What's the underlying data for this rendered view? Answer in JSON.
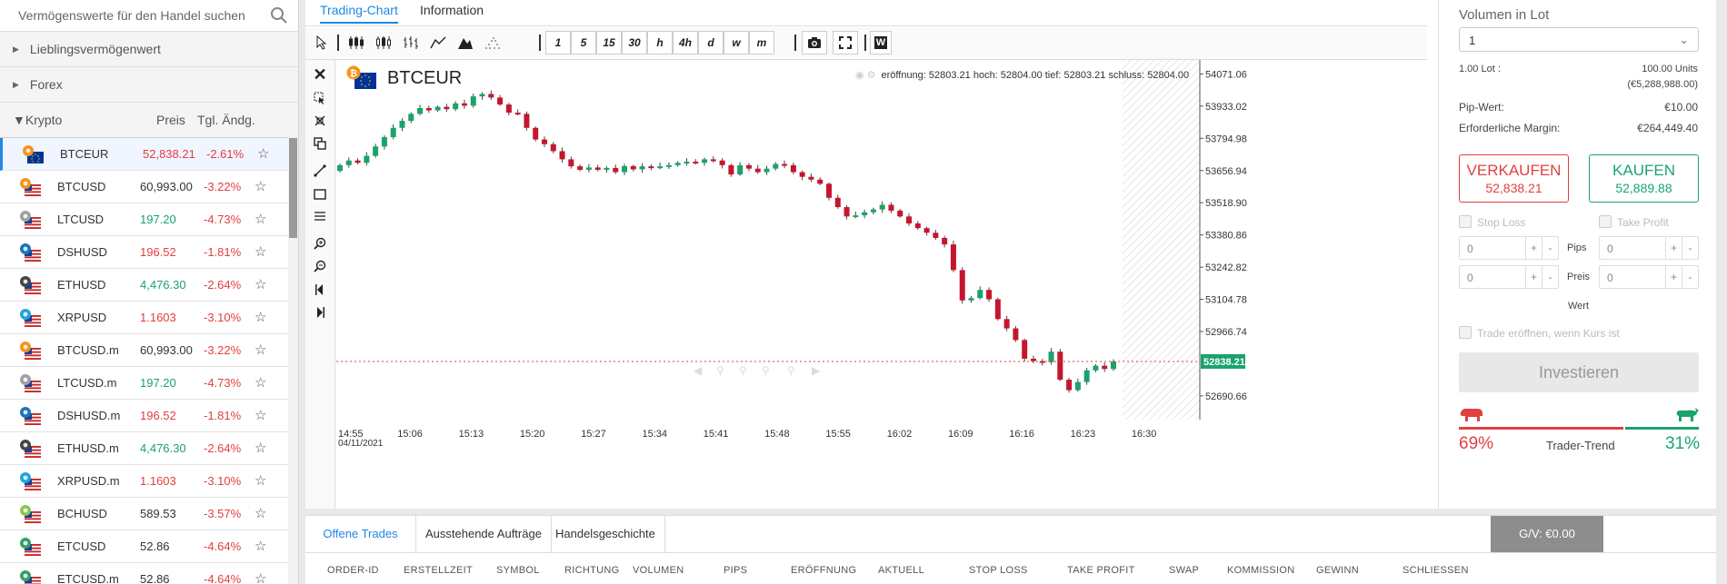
{
  "search": {
    "placeholder": "Vermögenswerte für den Handel suchen"
  },
  "groups": [
    {
      "label": "Lieblingsvermögenwert"
    },
    {
      "label": "Forex"
    }
  ],
  "krypto": {
    "label": "Krypto",
    "col_price": "Preis",
    "col_change": "Tgl. Ändg."
  },
  "assets": [
    {
      "symbol": "BTCEUR",
      "price": "52,838.21",
      "change": "-2.61%",
      "trend": "down",
      "icon": "bitcoin-euro-flag-icon",
      "color": "#f7931a",
      "flag": "eu"
    },
    {
      "symbol": "BTCUSD",
      "price": "60,993.00",
      "change": "-3.22%",
      "trend": "neutral",
      "icon": "bitcoin-us-flag-icon",
      "color": "#f7931a",
      "flag": "us"
    },
    {
      "symbol": "LTCUSD",
      "price": "197.20",
      "change": "-4.73%",
      "trend": "up",
      "icon": "litecoin-us-flag-icon",
      "color": "#a0a0a0",
      "flag": "us"
    },
    {
      "symbol": "DSHUSD",
      "price": "196.52",
      "change": "-1.81%",
      "trend": "down",
      "icon": "dash-us-flag-icon",
      "color": "#1c75bc",
      "flag": "us"
    },
    {
      "symbol": "ETHUSD",
      "price": "4,476.30",
      "change": "-2.64%",
      "trend": "up",
      "icon": "ethereum-us-flag-icon",
      "color": "#444444",
      "flag": "us"
    },
    {
      "symbol": "XRPUSD",
      "price": "1.1603",
      "change": "-3.10%",
      "trend": "down",
      "icon": "ripple-us-flag-icon",
      "color": "#23a3dd",
      "flag": "us"
    },
    {
      "symbol": "BTCUSD.m",
      "price": "60,993.00",
      "change": "-3.22%",
      "trend": "neutral",
      "icon": "bitcoin-us-flag-icon",
      "color": "#f7931a",
      "flag": "us"
    },
    {
      "symbol": "LTCUSD.m",
      "price": "197.20",
      "change": "-4.73%",
      "trend": "up",
      "icon": "litecoin-us-flag-icon",
      "color": "#a0a0a0",
      "flag": "us"
    },
    {
      "symbol": "DSHUSD.m",
      "price": "196.52",
      "change": "-1.81%",
      "trend": "down",
      "icon": "dash-us-flag-icon",
      "color": "#1c75bc",
      "flag": "us"
    },
    {
      "symbol": "ETHUSD.m",
      "price": "4,476.30",
      "change": "-2.64%",
      "trend": "up",
      "icon": "ethereum-us-flag-icon",
      "color": "#444444",
      "flag": "us"
    },
    {
      "symbol": "XRPUSD.m",
      "price": "1.1603",
      "change": "-3.10%",
      "trend": "down",
      "icon": "ripple-us-flag-icon",
      "color": "#23a3dd",
      "flag": "us"
    },
    {
      "symbol": "BCHUSD",
      "price": "589.53",
      "change": "-3.57%",
      "trend": "neutral",
      "icon": "bitcoin-cash-us-flag-icon",
      "color": "#8dc351",
      "flag": "us"
    },
    {
      "symbol": "ETCUSD",
      "price": "52.86",
      "change": "-4.64%",
      "trend": "neutral",
      "icon": "ethereum-classic-us-flag-icon",
      "color": "#33a065",
      "flag": "us"
    },
    {
      "symbol": "ETCUSD.m",
      "price": "52.86",
      "change": "-4.64%",
      "trend": "neutral",
      "icon": "ethereum-classic-us-flag-icon",
      "color": "#33a065",
      "flag": "us"
    }
  ],
  "chart_tabs": [
    {
      "label": "Trading-Chart"
    },
    {
      "label": "Information"
    }
  ],
  "toolbar": {
    "timeframes": [
      "1",
      "5",
      "15",
      "30",
      "h",
      "4h",
      "d",
      "w",
      "m"
    ],
    "icons": [
      "cursor-icon",
      "candles-icon",
      "hollow-candles-icon",
      "ohlc-bars-icon",
      "line-chart-icon",
      "area-chart-icon",
      "dots-chart-icon",
      "camera-icon",
      "fullscreen-icon",
      "w-icon"
    ],
    "w_label": "W"
  },
  "chart_header": {
    "symbol": "BTCEUR",
    "ohlc": "eröffnung: 52803.21 hoch: 52804.00 tief: 52803.21 schluss: 52804.00"
  },
  "chart_data": {
    "type": "candlestick",
    "title": "BTCEUR",
    "x_ticks": [
      "14:55",
      "15:06",
      "15:13",
      "15:20",
      "15:27",
      "15:34",
      "15:41",
      "15:48",
      "15:55",
      "16:02",
      "16:09",
      "16:16",
      "16:23",
      "16:30"
    ],
    "date_label": "04/11/2021",
    "y_ticks": [
      "54071.06",
      "53933.02",
      "53794.98",
      "53656.94",
      "53518.90",
      "53380.86",
      "53242.82",
      "53104.78",
      "52966.74",
      "52690.66"
    ],
    "ylim": [
      52620,
      54100
    ],
    "current_price": "52838.21",
    "closes": [
      53680,
      53700,
      53690,
      53720,
      53760,
      53800,
      53840,
      53870,
      53900,
      53925,
      53915,
      53930,
      53920,
      53945,
      53935,
      53975,
      53985,
      53970,
      53940,
      53905,
      53900,
      53840,
      53790,
      53770,
      53740,
      53705,
      53675,
      53660,
      53670,
      53660,
      53668,
      53650,
      53676,
      53662,
      53675,
      53668,
      53675,
      53680,
      53690,
      53695,
      53690,
      53705,
      53700,
      53680,
      53640,
      53680,
      53665,
      53650,
      53665,
      53685,
      53680,
      53650,
      53630,
      53618,
      53600,
      53540,
      53500,
      53460,
      53465,
      53478,
      53490,
      53510,
      53485,
      53460,
      53430,
      53410,
      53390,
      53368,
      53340,
      53230,
      53100,
      53110,
      53145,
      53105,
      53020,
      52980,
      52930,
      52850,
      52840,
      52835,
      52880,
      52760,
      52715,
      52750,
      52800,
      52820,
      52806,
      52838
    ]
  },
  "right_panel": {
    "volume_label": "Volumen in Lot",
    "volume_value": "1",
    "lot_label": "1.00 Lot :",
    "lot_units": "100.00 Units",
    "lot_value": "(€5,288,988.00)",
    "pip_label": "Pip-Wert:",
    "pip_value": "€10.00",
    "margin_label": "Erforderliche Margin:",
    "margin_value": "€264,449.40",
    "sell_label": "VERKAUFEN",
    "sell_price": "52,838.21",
    "buy_label": "KAUFEN",
    "buy_price": "52,889.88",
    "stop_loss": "Stop Loss",
    "take_profit": "Take Profit",
    "pips_label": "Pips",
    "preis_label": "Preis",
    "wert_label": "Wert",
    "zero": "0",
    "trade_open_label": "Trade eröffnen, wenn Kurs ist",
    "invest_label": "Investieren",
    "sell_pct": "69%",
    "buy_pct": "31%",
    "sell_fraction": 0.69,
    "trend_label": "Trader-Trend"
  },
  "bottom": {
    "tabs": [
      {
        "label": "Offene Trades"
      },
      {
        "label": "Ausstehende Aufträge"
      },
      {
        "label": "Handelsgeschichte"
      }
    ],
    "pnl": "G/V: €0.00",
    "columns": [
      "ORDER-ID",
      "ERSTELLZEIT",
      "SYMBOL",
      "RICHTUNG",
      "VOLUMEN",
      "PIPS",
      "ERÖFFNUNG",
      "AKTUELL",
      "STOP LOSS",
      "TAKE PROFIT",
      "SWAP",
      "KOMMISSION",
      "GEWINN",
      "SCHLIESSEN"
    ]
  }
}
